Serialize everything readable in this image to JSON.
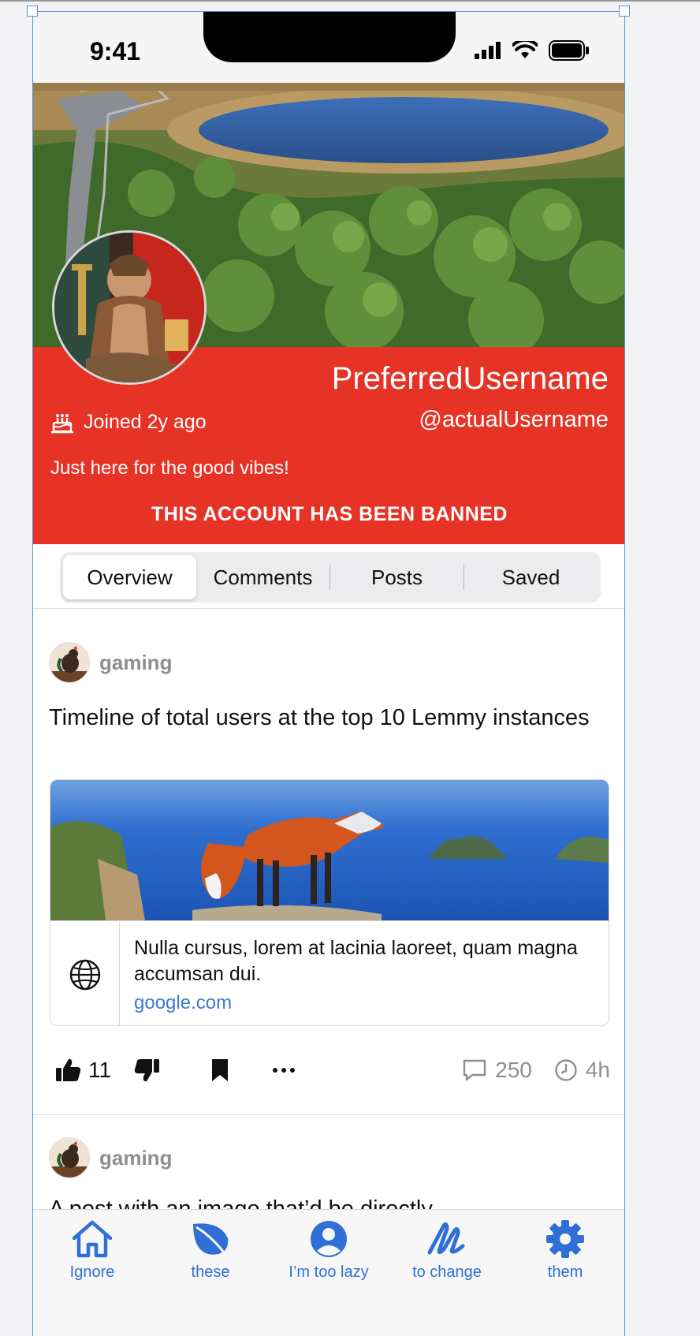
{
  "status_bar": {
    "time": "9:41"
  },
  "profile": {
    "display_name": "PreferredUsername",
    "username": "@actualUsername",
    "joined": "Joined 2y ago",
    "bio": "Just here for the good vibes!",
    "banned_notice": "THIS ACCOUNT HAS BEEN BANNED",
    "panel_color": "#e73325"
  },
  "tabs": [
    {
      "label": "Overview",
      "selected": true
    },
    {
      "label": "Comments",
      "selected": false
    },
    {
      "label": "Posts",
      "selected": false
    },
    {
      "label": "Saved",
      "selected": false
    }
  ],
  "posts": [
    {
      "community": "gaming",
      "title": "Timeline of total users at the top 10 Lemmy instances",
      "link": {
        "description": "Nulla cursus, lorem at lacinia laoreet, quam magna accumsan dui.",
        "url": "google.com"
      },
      "upvotes": "11",
      "comments": "250",
      "age": "4h"
    },
    {
      "community": "gaming",
      "title": "A post with an image that’d be directly"
    }
  ],
  "tab_bar": [
    {
      "label": "Ignore",
      "icon": "house-icon"
    },
    {
      "label": "these",
      "icon": "leaf-icon"
    },
    {
      "label": "I’m too lazy",
      "icon": "person-icon"
    },
    {
      "label": "to change",
      "icon": "scribble-icon"
    },
    {
      "label": "them",
      "icon": "gear-icon"
    }
  ],
  "colors": {
    "accent": "#2f6fd6",
    "link": "#3b78d8",
    "selection": "#5b8fd6"
  }
}
